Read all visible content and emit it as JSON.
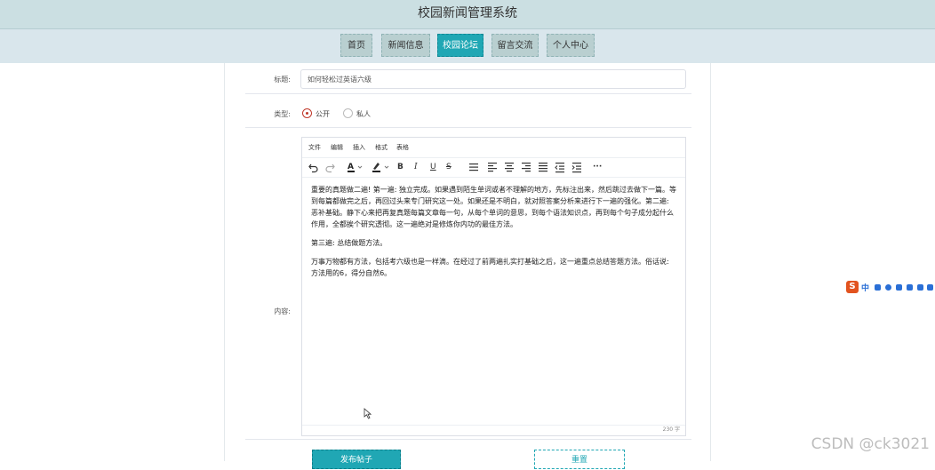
{
  "app": {
    "title": "校园新闻管理系统"
  },
  "nav": {
    "items": [
      {
        "label": "首页"
      },
      {
        "label": "新闻信息"
      },
      {
        "label": "校园论坛"
      },
      {
        "label": "留言交流"
      },
      {
        "label": "个人中心"
      }
    ],
    "active_index": 2
  },
  "form": {
    "title_label": "标题:",
    "title_value": "如何轻松过英语六级",
    "type_label": "类型:",
    "type_options": [
      {
        "label": "公开",
        "selected": true
      },
      {
        "label": "私人",
        "selected": false
      }
    ],
    "content_label": "内容:"
  },
  "editor": {
    "menus": [
      "文件",
      "编辑",
      "插入",
      "格式",
      "表格"
    ],
    "paragraphs": [
      "重要的真题做二遍! 第一遍: 独立完成。如果遇到陌生单词或者不理解的地方，先标注出来，然后跳过去做下一篇。等到每篇都做完之后，再回过头来专门研究这一处。如果还是不明白，就对照答案分析来进行下一遍的强化。第二遍: 恶补基础。静下心来把再复真题每篇文章每一句，从每个单词的意思，到每个语法知识点，再到每个句子成分起什么作用，全都挨个研究透彻。这一遍绝对是修炼你内功的最佳方法。",
      "第三遍: 总结做题方法。",
      "万事万物都有方法，包括考六级也是一样滴。在经过了前两遍扎实打基础之后，这一遍重点总结答题方法。俗话说: 方法用的6，得分自然6。"
    ],
    "word_count": "230 字"
  },
  "buttons": {
    "submit": "发布帖子",
    "reset": "重置"
  },
  "ime": {
    "glyph": "S",
    "lang": "中"
  },
  "watermark": "CSDN @ck3021",
  "colors": {
    "accent": "#20a7b4",
    "header_bg": "#cbdfe2",
    "nav_bg": "#d9e6ec",
    "radio_selected": "#c0392b"
  }
}
